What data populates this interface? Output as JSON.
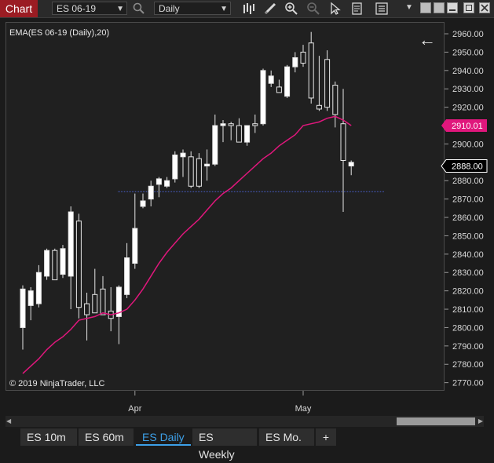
{
  "toolbar": {
    "chart_tab": "Chart",
    "instrument": "ES 06-19",
    "interval": "Daily",
    "icons": [
      "search-icon",
      "bar-type-icon",
      "draw-icon",
      "zoom-in-icon",
      "zoom-out-icon",
      "pointer-icon",
      "properties-icon",
      "options-icon",
      "dropdown-icon"
    ]
  },
  "chart": {
    "indicator_label": "EMA(ES 06-19 (Daily),20)",
    "copyright": "© 2019 NinjaTrader, LLC",
    "ema_color": "#e0177c",
    "ema_value_label": "2910.01",
    "last_price_label": "2888.00",
    "x_labels": [
      "Apr",
      "May"
    ],
    "y_ticks": [
      "2960.00",
      "2950.00",
      "2940.00",
      "2930.00",
      "2920.00",
      "2910.00",
      "2900.00",
      "2890.00",
      "2880.00",
      "2870.00",
      "2860.00",
      "2850.00",
      "2840.00",
      "2830.00",
      "2820.00",
      "2810.00",
      "2800.00",
      "2790.00",
      "2780.00",
      "2770.00"
    ]
  },
  "chart_data": {
    "type": "candlestick",
    "title": "",
    "ylim": [
      2766,
      2966
    ],
    "x_ticks": [
      {
        "label": "Apr",
        "index": 14
      },
      {
        "label": "May",
        "index": 35
      }
    ],
    "horizontal_line": 2874,
    "candles": [
      {
        "o": 2800,
        "h": 2823,
        "l": 2788,
        "c": 2821
      },
      {
        "o": 2812,
        "h": 2822,
        "l": 2804,
        "c": 2820
      },
      {
        "o": 2813,
        "h": 2834,
        "l": 2811,
        "c": 2830
      },
      {
        "o": 2828,
        "h": 2843,
        "l": 2826,
        "c": 2842
      },
      {
        "o": 2842,
        "h": 2843,
        "l": 2829,
        "c": 2826
      },
      {
        "o": 2829,
        "h": 2845,
        "l": 2827,
        "c": 2843
      },
      {
        "o": 2828,
        "h": 2866,
        "l": 2810,
        "c": 2863
      },
      {
        "o": 2858,
        "h": 2862,
        "l": 2805,
        "c": 2811
      },
      {
        "o": 2813,
        "h": 2819,
        "l": 2793,
        "c": 2807
      },
      {
        "o": 2818,
        "h": 2832,
        "l": 2809,
        "c": 2808
      },
      {
        "o": 2821,
        "h": 2828,
        "l": 2813,
        "c": 2807
      },
      {
        "o": 2809,
        "h": 2822,
        "l": 2798,
        "c": 2805
      },
      {
        "o": 2806,
        "h": 2823,
        "l": 2791,
        "c": 2822
      },
      {
        "o": 2818,
        "h": 2846,
        "l": 2816,
        "c": 2838
      },
      {
        "o": 2835,
        "h": 2873,
        "l": 2832,
        "c": 2854
      },
      {
        "o": 2866,
        "h": 2873,
        "l": 2865,
        "c": 2869
      },
      {
        "o": 2870,
        "h": 2880,
        "l": 2866,
        "c": 2877
      },
      {
        "o": 2878,
        "h": 2882,
        "l": 2871,
        "c": 2881
      },
      {
        "o": 2877,
        "h": 2882,
        "l": 2876,
        "c": 2880
      },
      {
        "o": 2881,
        "h": 2896,
        "l": 2879,
        "c": 2894
      },
      {
        "o": 2893,
        "h": 2897,
        "l": 2882,
        "c": 2895
      },
      {
        "o": 2893,
        "h": 2896,
        "l": 2876,
        "c": 2877
      },
      {
        "o": 2892,
        "h": 2895,
        "l": 2876,
        "c": 2877
      },
      {
        "o": 2888,
        "h": 2897,
        "l": 2880,
        "c": 2889
      },
      {
        "o": 2889,
        "h": 2916,
        "l": 2888,
        "c": 2910
      },
      {
        "o": 2910,
        "h": 2913,
        "l": 2901,
        "c": 2911
      },
      {
        "o": 2911,
        "h": 2912,
        "l": 2902,
        "c": 2910
      },
      {
        "o": 2910,
        "h": 2914,
        "l": 2901,
        "c": 2901
      },
      {
        "o": 2901,
        "h": 2910,
        "l": 2899,
        "c": 2910
      },
      {
        "o": 2911,
        "h": 2916,
        "l": 2906,
        "c": 2910
      },
      {
        "o": 2911,
        "h": 2941,
        "l": 2910,
        "c": 2940
      },
      {
        "o": 2933,
        "h": 2940,
        "l": 2931,
        "c": 2937
      },
      {
        "o": 2931,
        "h": 2935,
        "l": 2928,
        "c": 2928
      },
      {
        "o": 2926,
        "h": 2943,
        "l": 2925,
        "c": 2942
      },
      {
        "o": 2942,
        "h": 2950,
        "l": 2939,
        "c": 2947
      },
      {
        "o": 2950,
        "h": 2954,
        "l": 2942,
        "c": 2944
      },
      {
        "o": 2955,
        "h": 2961,
        "l": 2922,
        "c": 2925
      },
      {
        "o": 2921,
        "h": 2948,
        "l": 2918,
        "c": 2919
      },
      {
        "o": 2946,
        "h": 2951,
        "l": 2918,
        "c": 2920
      },
      {
        "o": 2932,
        "h": 2934,
        "l": 2909,
        "c": 2916
      },
      {
        "o": 2911,
        "h": 2930,
        "l": 2863,
        "c": 2891
      },
      {
        "o": 2888,
        "h": 2891,
        "l": 2883,
        "c": 2890
      }
    ],
    "ema": [
      2775,
      2779,
      2783,
      2788,
      2792,
      2795,
      2799,
      2804,
      2805,
      2806,
      2808,
      2807,
      2808,
      2810,
      2815,
      2821,
      2828,
      2835,
      2841,
      2846,
      2851,
      2855,
      2859,
      2864,
      2869,
      2873,
      2876,
      2880,
      2884,
      2888,
      2892,
      2895,
      2899,
      2902,
      2905,
      2910,
      2911,
      2912,
      2914,
      2915,
      2913,
      2910
    ]
  },
  "tabs": {
    "items": [
      "ES 10m",
      "ES 60m",
      "ES Daily",
      "ES Weekly",
      "ES Mo."
    ],
    "add_label": "+"
  }
}
